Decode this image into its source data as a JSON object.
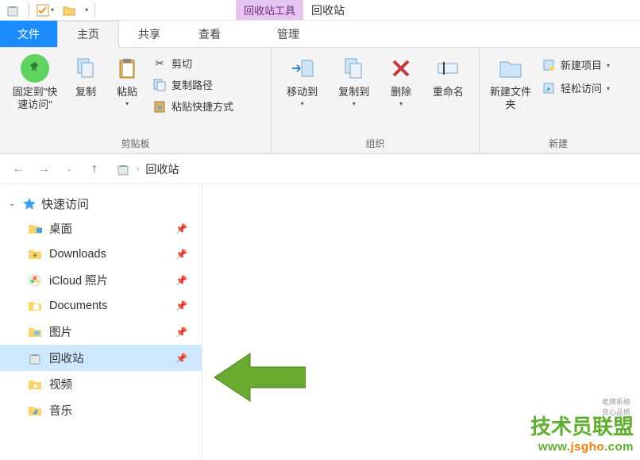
{
  "titlebar": {
    "context_tab": "回收站工具",
    "window_title": "回收站"
  },
  "tabs": {
    "file": "文件",
    "home": "主页",
    "share": "共享",
    "view": "查看",
    "manage": "管理"
  },
  "ribbon": {
    "pin_label": "固定到\"快速访问\"",
    "copy": "复制",
    "paste": "粘贴",
    "cut": "剪切",
    "copy_path": "复制路径",
    "paste_shortcut": "粘贴快捷方式",
    "clipboard_group": "剪贴板",
    "move_to": "移动到",
    "copy_to": "复制到",
    "delete": "删除",
    "rename": "重命名",
    "organize_group": "组织",
    "new_folder": "新建文件夹",
    "new_item": "新建项目",
    "easy_access": "轻松访问",
    "new_group": "新建"
  },
  "breadcrumb": {
    "location": "回收站"
  },
  "sidebar": {
    "quick_access": "快速访问",
    "items": [
      {
        "label": "桌面"
      },
      {
        "label": "Downloads"
      },
      {
        "label": "iCloud 照片"
      },
      {
        "label": "Documents"
      },
      {
        "label": "图片"
      },
      {
        "label": "回收站"
      },
      {
        "label": "视频"
      },
      {
        "label": "音乐"
      }
    ]
  },
  "watermark": {
    "title": "技术员联盟",
    "url_1": "www.",
    "url_2": "jsgho",
    "url_3": ".com",
    "small": "老牌系统\n良心品质"
  }
}
